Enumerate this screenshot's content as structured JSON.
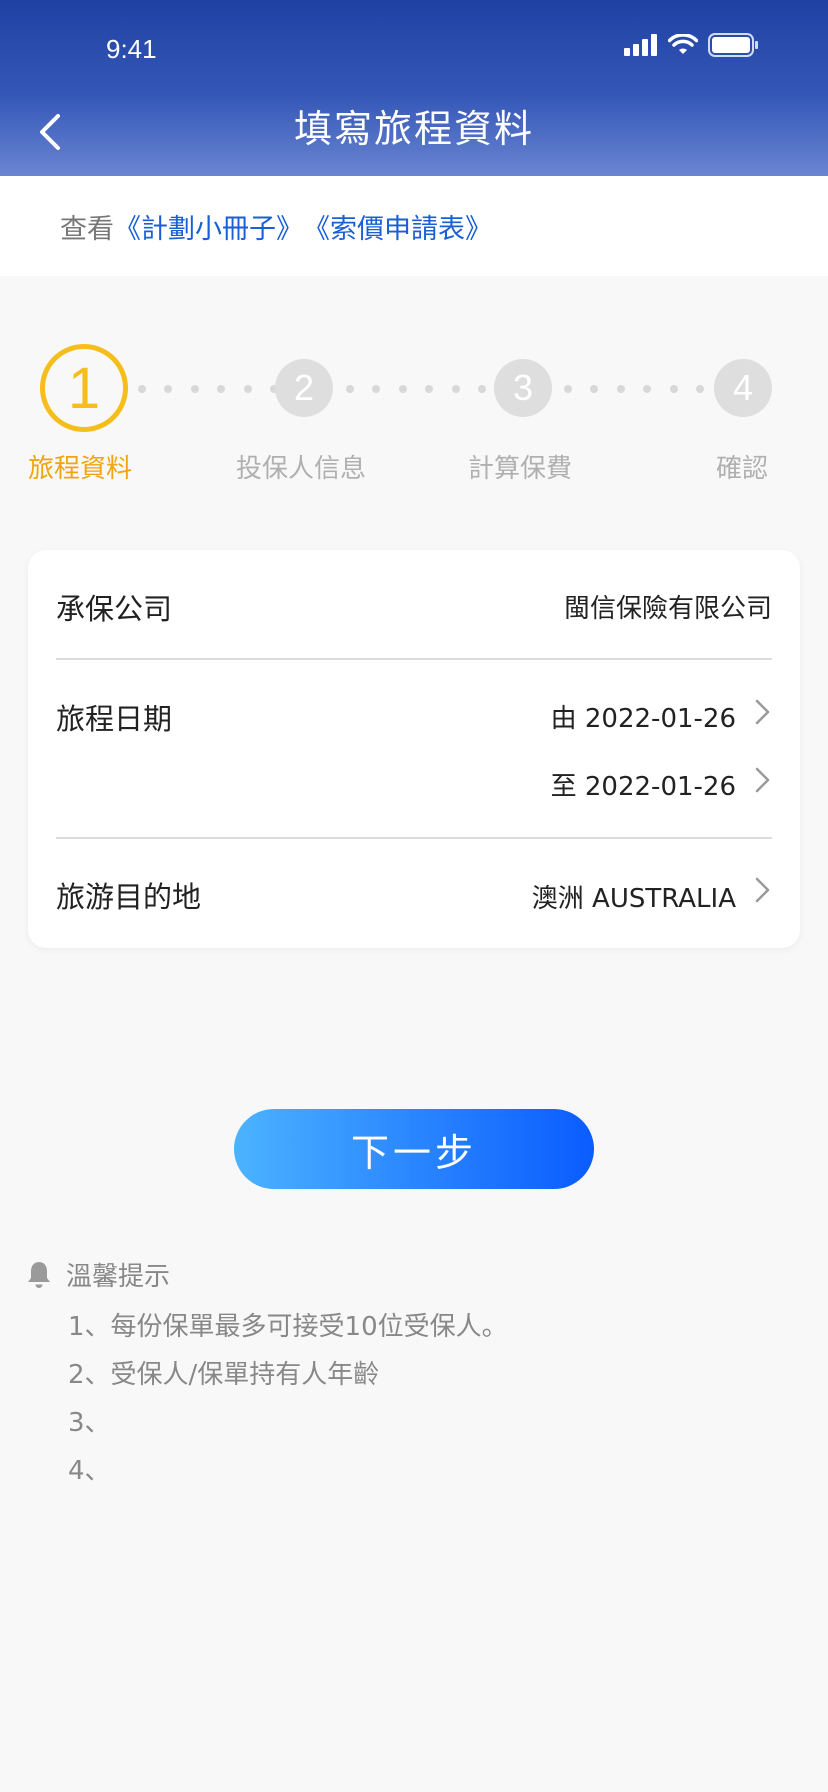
{
  "status_bar": {
    "time": "9:41"
  },
  "header": {
    "title": "填寫旅程資料"
  },
  "links": {
    "prefix": "查看",
    "plan_booklet": "《計劃小冊子》",
    "quote_form": "《索價申請表》"
  },
  "steps": [
    {
      "number": "1",
      "label": "旅程資料",
      "active": true
    },
    {
      "number": "2",
      "label": "投保人信息",
      "active": false
    },
    {
      "number": "3",
      "label": "計算保費",
      "active": false
    },
    {
      "number": "4",
      "label": "確認",
      "active": false
    }
  ],
  "form": {
    "insurer_label": "承保公司",
    "insurer_value": "閩信保險有限公司",
    "trip_date_label": "旅程日期",
    "date_from": "由 2022-01-26",
    "date_to": "至 2022-01-26",
    "destination_label": "旅游目的地",
    "destination_value": "澳洲 AUSTRALIA"
  },
  "next_button": {
    "label": "下一步"
  },
  "tips": {
    "title": "溫馨提示",
    "items": [
      "1、每份保單最多可接受10位受保人。",
      "2、受保人/保單持有人年齡",
      "3、",
      "4、"
    ]
  },
  "colors": {
    "header_top": "#1e41a3",
    "header_bottom": "#6a85d1",
    "active_step": "#f6be1a",
    "link": "#1a5fd6",
    "button_start": "#4cb3ff",
    "button_end": "#0a5cff"
  }
}
